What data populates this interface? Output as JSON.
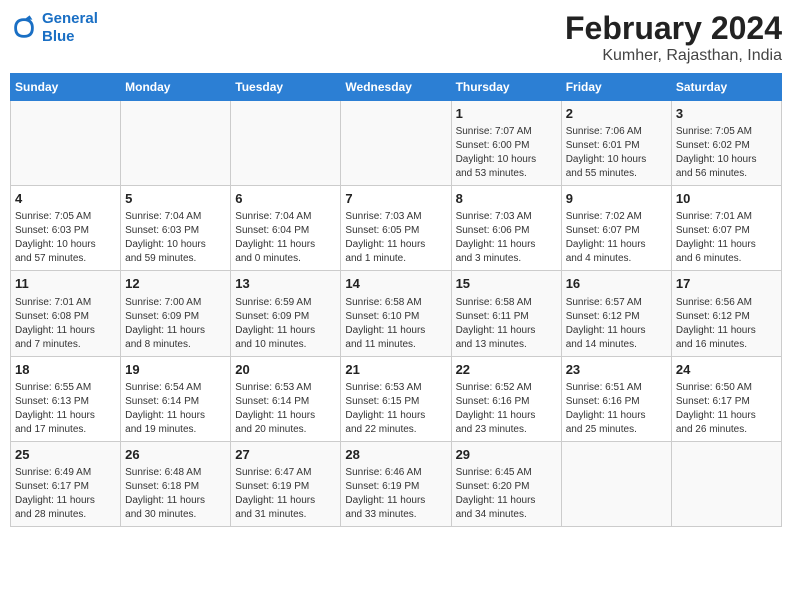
{
  "header": {
    "logo_line1": "General",
    "logo_line2": "Blue",
    "main_title": "February 2024",
    "subtitle": "Kumher, Rajasthan, India"
  },
  "weekdays": [
    "Sunday",
    "Monday",
    "Tuesday",
    "Wednesday",
    "Thursday",
    "Friday",
    "Saturday"
  ],
  "weeks": [
    [
      {
        "day": "",
        "info": ""
      },
      {
        "day": "",
        "info": ""
      },
      {
        "day": "",
        "info": ""
      },
      {
        "day": "",
        "info": ""
      },
      {
        "day": "1",
        "info": "Sunrise: 7:07 AM\nSunset: 6:00 PM\nDaylight: 10 hours\nand 53 minutes."
      },
      {
        "day": "2",
        "info": "Sunrise: 7:06 AM\nSunset: 6:01 PM\nDaylight: 10 hours\nand 55 minutes."
      },
      {
        "day": "3",
        "info": "Sunrise: 7:05 AM\nSunset: 6:02 PM\nDaylight: 10 hours\nand 56 minutes."
      }
    ],
    [
      {
        "day": "4",
        "info": "Sunrise: 7:05 AM\nSunset: 6:03 PM\nDaylight: 10 hours\nand 57 minutes."
      },
      {
        "day": "5",
        "info": "Sunrise: 7:04 AM\nSunset: 6:03 PM\nDaylight: 10 hours\nand 59 minutes."
      },
      {
        "day": "6",
        "info": "Sunrise: 7:04 AM\nSunset: 6:04 PM\nDaylight: 11 hours\nand 0 minutes."
      },
      {
        "day": "7",
        "info": "Sunrise: 7:03 AM\nSunset: 6:05 PM\nDaylight: 11 hours\nand 1 minute."
      },
      {
        "day": "8",
        "info": "Sunrise: 7:03 AM\nSunset: 6:06 PM\nDaylight: 11 hours\nand 3 minutes."
      },
      {
        "day": "9",
        "info": "Sunrise: 7:02 AM\nSunset: 6:07 PM\nDaylight: 11 hours\nand 4 minutes."
      },
      {
        "day": "10",
        "info": "Sunrise: 7:01 AM\nSunset: 6:07 PM\nDaylight: 11 hours\nand 6 minutes."
      }
    ],
    [
      {
        "day": "11",
        "info": "Sunrise: 7:01 AM\nSunset: 6:08 PM\nDaylight: 11 hours\nand 7 minutes."
      },
      {
        "day": "12",
        "info": "Sunrise: 7:00 AM\nSunset: 6:09 PM\nDaylight: 11 hours\nand 8 minutes."
      },
      {
        "day": "13",
        "info": "Sunrise: 6:59 AM\nSunset: 6:09 PM\nDaylight: 11 hours\nand 10 minutes."
      },
      {
        "day": "14",
        "info": "Sunrise: 6:58 AM\nSunset: 6:10 PM\nDaylight: 11 hours\nand 11 minutes."
      },
      {
        "day": "15",
        "info": "Sunrise: 6:58 AM\nSunset: 6:11 PM\nDaylight: 11 hours\nand 13 minutes."
      },
      {
        "day": "16",
        "info": "Sunrise: 6:57 AM\nSunset: 6:12 PM\nDaylight: 11 hours\nand 14 minutes."
      },
      {
        "day": "17",
        "info": "Sunrise: 6:56 AM\nSunset: 6:12 PM\nDaylight: 11 hours\nand 16 minutes."
      }
    ],
    [
      {
        "day": "18",
        "info": "Sunrise: 6:55 AM\nSunset: 6:13 PM\nDaylight: 11 hours\nand 17 minutes."
      },
      {
        "day": "19",
        "info": "Sunrise: 6:54 AM\nSunset: 6:14 PM\nDaylight: 11 hours\nand 19 minutes."
      },
      {
        "day": "20",
        "info": "Sunrise: 6:53 AM\nSunset: 6:14 PM\nDaylight: 11 hours\nand 20 minutes."
      },
      {
        "day": "21",
        "info": "Sunrise: 6:53 AM\nSunset: 6:15 PM\nDaylight: 11 hours\nand 22 minutes."
      },
      {
        "day": "22",
        "info": "Sunrise: 6:52 AM\nSunset: 6:16 PM\nDaylight: 11 hours\nand 23 minutes."
      },
      {
        "day": "23",
        "info": "Sunrise: 6:51 AM\nSunset: 6:16 PM\nDaylight: 11 hours\nand 25 minutes."
      },
      {
        "day": "24",
        "info": "Sunrise: 6:50 AM\nSunset: 6:17 PM\nDaylight: 11 hours\nand 26 minutes."
      }
    ],
    [
      {
        "day": "25",
        "info": "Sunrise: 6:49 AM\nSunset: 6:17 PM\nDaylight: 11 hours\nand 28 minutes."
      },
      {
        "day": "26",
        "info": "Sunrise: 6:48 AM\nSunset: 6:18 PM\nDaylight: 11 hours\nand 30 minutes."
      },
      {
        "day": "27",
        "info": "Sunrise: 6:47 AM\nSunset: 6:19 PM\nDaylight: 11 hours\nand 31 minutes."
      },
      {
        "day": "28",
        "info": "Sunrise: 6:46 AM\nSunset: 6:19 PM\nDaylight: 11 hours\nand 33 minutes."
      },
      {
        "day": "29",
        "info": "Sunrise: 6:45 AM\nSunset: 6:20 PM\nDaylight: 11 hours\nand 34 minutes."
      },
      {
        "day": "",
        "info": ""
      },
      {
        "day": "",
        "info": ""
      }
    ]
  ]
}
